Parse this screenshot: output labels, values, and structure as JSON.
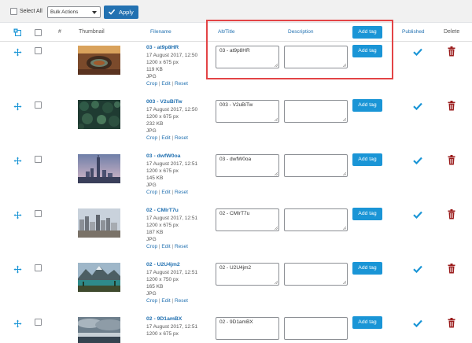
{
  "toolbar": {
    "select_all_label": "Select All",
    "bulk_actions_value": "Bulk Actions",
    "apply_label": "Apply",
    "accent_color": "#2271b1"
  },
  "columns": {
    "index": "#",
    "thumbnail": "Thumbnail",
    "filename": "Filename",
    "alt_title": "Alt/Title",
    "description": "Description",
    "add_tag": "Add tag",
    "published": "Published",
    "delete": "Delete"
  },
  "row_actions": {
    "crop": "Crop",
    "edit": "Edit",
    "reset": "Reset",
    "sep": "|"
  },
  "rows": [
    {
      "filename": "03 - at9p8HR",
      "date": "17 August 2017, 12:50",
      "dimensions": "1200 x 675 px",
      "size": "119 KB",
      "type": "JPG",
      "alt": "03 - at9p8HR",
      "description": "",
      "add_tag": "Add tag",
      "thumb": "horseshoe-bend"
    },
    {
      "filename": "003 - V2uBiTw",
      "date": "17 August 2017, 12:50",
      "dimensions": "1200 x 675 px",
      "size": "232 KB",
      "type": "JPG",
      "alt": "003 - V2uBiTw",
      "description": "",
      "add_tag": "Add tag",
      "thumb": "forest-aerial"
    },
    {
      "filename": "03 - dwfW0oa",
      "date": "17 August 2017, 12:51",
      "dimensions": "1200 x 675 px",
      "size": "145 KB",
      "type": "JPG",
      "alt": "03 - dwfW0oa",
      "description": "",
      "add_tag": "Add tag",
      "thumb": "city-skyline-dusk"
    },
    {
      "filename": "02 - CMIrT7u",
      "date": "17 August 2017, 12:51",
      "dimensions": "1200 x 675 px",
      "size": "187 KB",
      "type": "JPG",
      "alt": "02 - CMIrT7u",
      "description": "",
      "add_tag": "Add tag",
      "thumb": "city-skyline-day"
    },
    {
      "filename": "02 - U2U4jm2",
      "date": "17 August 2017, 12:51",
      "dimensions": "1200 x 750 px",
      "size": "165 KB",
      "type": "JPG",
      "alt": "02 - U2U4jm2",
      "description": "",
      "add_tag": "Add tag",
      "thumb": "mountain-lake"
    },
    {
      "filename": "02 - 9D1amBX",
      "date": "17 August 2017, 12:51",
      "dimensions": "1200 x 675 px",
      "size": "",
      "type": "",
      "alt": "02 - 9D1amBX",
      "description": "",
      "add_tag": "Add tag",
      "thumb": "cloudy-coast"
    }
  ],
  "icons": {
    "move": "move-arrows-icon",
    "published": "checkmark-icon",
    "delete": "trash-icon",
    "header": "add-image-icon"
  },
  "colors": {
    "link": "#2271b1",
    "button": "#1a95d6",
    "delete": "#9b1c1c",
    "highlight": "#e34446"
  }
}
